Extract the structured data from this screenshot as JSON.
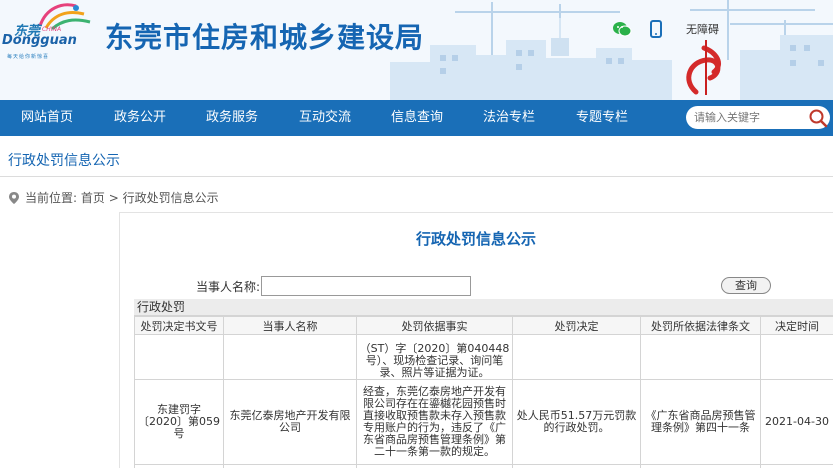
{
  "site": {
    "logo_cn": "东莞",
    "logo_en": "CHINA",
    "logo_city": "Dongguan",
    "logo_slogan": "每天给你新惊喜",
    "title": "东莞市住房和城乡建设局",
    "accessibility": "无障碍"
  },
  "nav": {
    "items": [
      "网站首页",
      "政务公开",
      "政务服务",
      "互动交流",
      "信息查询",
      "法治专栏",
      "专题专栏"
    ],
    "search_placeholder": "请输入关键字"
  },
  "page": {
    "heading": "行政处罚信息公示",
    "breadcrumb_label": "当前位置:",
    "breadcrumb_home": "首页",
    "breadcrumb_sep": ">",
    "breadcrumb_current": "行政处罚信息公示"
  },
  "panel": {
    "title": "行政处罚信息公示",
    "query_label": "当事人名称:",
    "query_value": "",
    "query_button": "查询",
    "table_caption": "行政处罚"
  },
  "table": {
    "headers": [
      "处罚决定书文号",
      "当事人名称",
      "处罚依据事实",
      "处罚决定",
      "处罚所依据法律条文",
      "决定时间"
    ],
    "rows": [
      {
        "doc_no": "",
        "party": "",
        "fact": "（ST）字〔2020〕第040448号）、现场检查记录、询问笔录、照片等证据为证。",
        "decision": "",
        "law": "",
        "date": ""
      },
      {
        "doc_no": "东建罚字〔2020〕第059号",
        "party": "东莞亿泰房地产开发有限公司",
        "fact": "经查，东莞亿泰房地产开发有限公司存在在鎏樾花园预售时直接收取预售款未存入预售款专用账户的行为，违反了《广东省商品房预售管理条例》第二十一条第一款的规定。",
        "decision": "处人民币51.57万元罚款的行政处罚。",
        "law": "《广东省商品房预售管理条例》第四十一条",
        "date": "2021-04-30"
      }
    ]
  },
  "colors": {
    "brand_blue": "#1565b2",
    "nav_blue": "#1a6fb8"
  }
}
